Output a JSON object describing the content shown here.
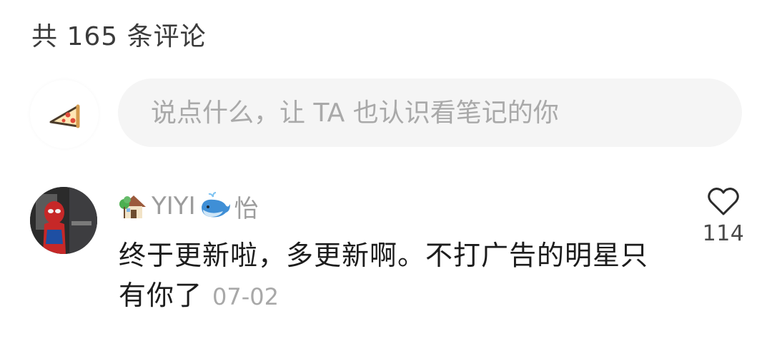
{
  "header": {
    "comment_count_label": "共 165 条评论"
  },
  "composer": {
    "avatar_icon": "pizza-icon",
    "placeholder": "说点什么，让 TA 也认识看笔记的你"
  },
  "comment": {
    "avatar_icon": "spiderman-avatar",
    "username_prefix_icon": "house-emoji-icon",
    "username": "YIYI",
    "username_middle_icon": "whale-emoji-icon",
    "username_suffix": "怡",
    "text": "终于更新啦，多更新啊。不打广告的明星只有你了",
    "date": "07-02",
    "like_icon": "heart-outline-icon",
    "like_count": "114"
  },
  "colors": {
    "background": "#ffffff",
    "input_background": "#f5f5f5",
    "placeholder": "#a9a9a9",
    "meta_text": "#9c9c9c"
  }
}
